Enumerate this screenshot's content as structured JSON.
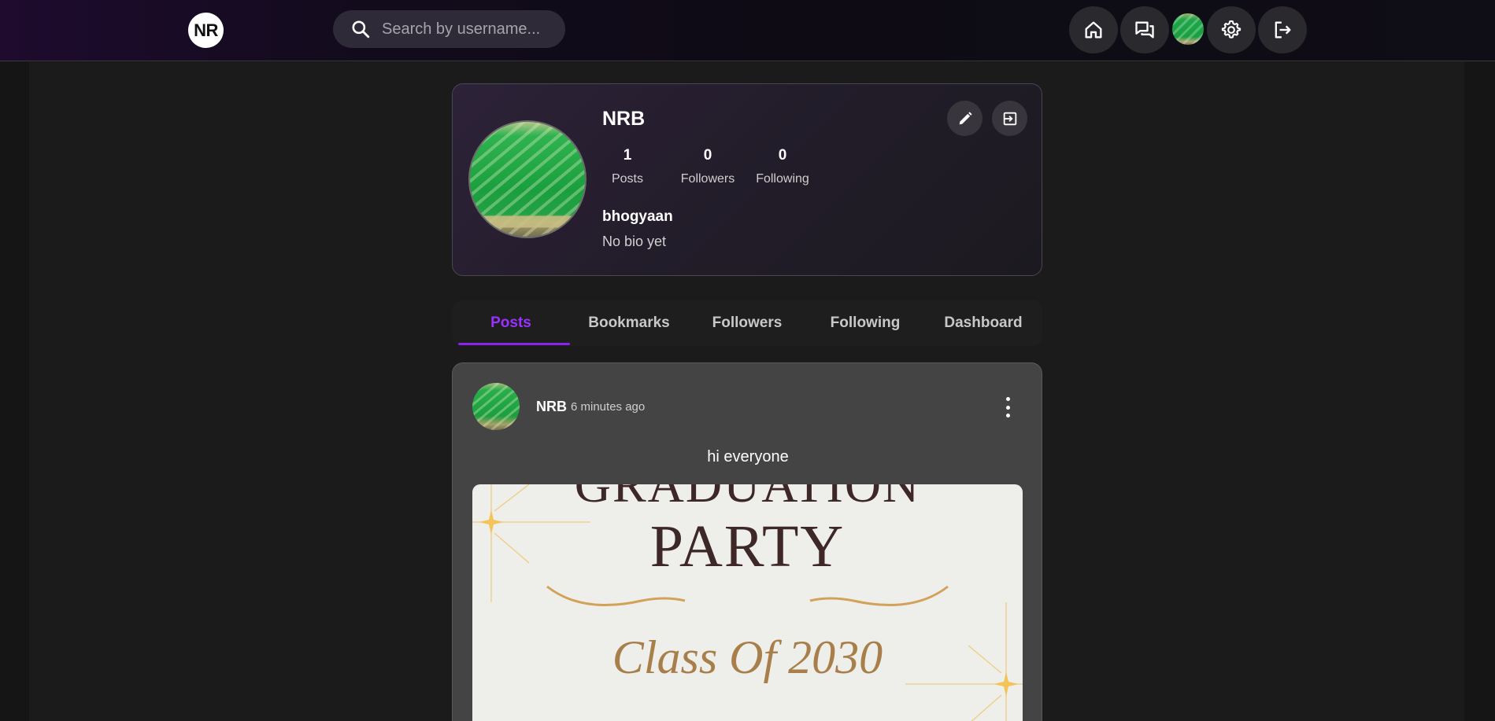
{
  "navbar": {
    "logo_text": "NR",
    "search": {
      "placeholder": "Search by username..."
    },
    "icons": [
      "home-icon",
      "messages-icon",
      "user-avatar",
      "settings-icon",
      "logout-icon"
    ]
  },
  "profile": {
    "name": "NRB",
    "stats": [
      {
        "value": "1",
        "label": "Posts"
      },
      {
        "value": "0",
        "label": "Followers"
      },
      {
        "value": "0",
        "label": "Following"
      }
    ],
    "username": "bhogyaan",
    "bio": "No bio yet"
  },
  "tabs": [
    {
      "label": "Posts",
      "active": true
    },
    {
      "label": "Bookmarks",
      "active": false
    },
    {
      "label": "Followers",
      "active": false
    },
    {
      "label": "Following",
      "active": false
    },
    {
      "label": "Dashboard",
      "active": false
    }
  ],
  "post": {
    "author": "NRB",
    "time": "6 minutes ago",
    "text": "hi everyone",
    "image": {
      "line1": "GRADUATION",
      "line2": "PARTY",
      "line3": "Class Of 2030"
    }
  },
  "colors": {
    "accent": "#9b30ff",
    "background": "#151515",
    "card": "#444444"
  }
}
